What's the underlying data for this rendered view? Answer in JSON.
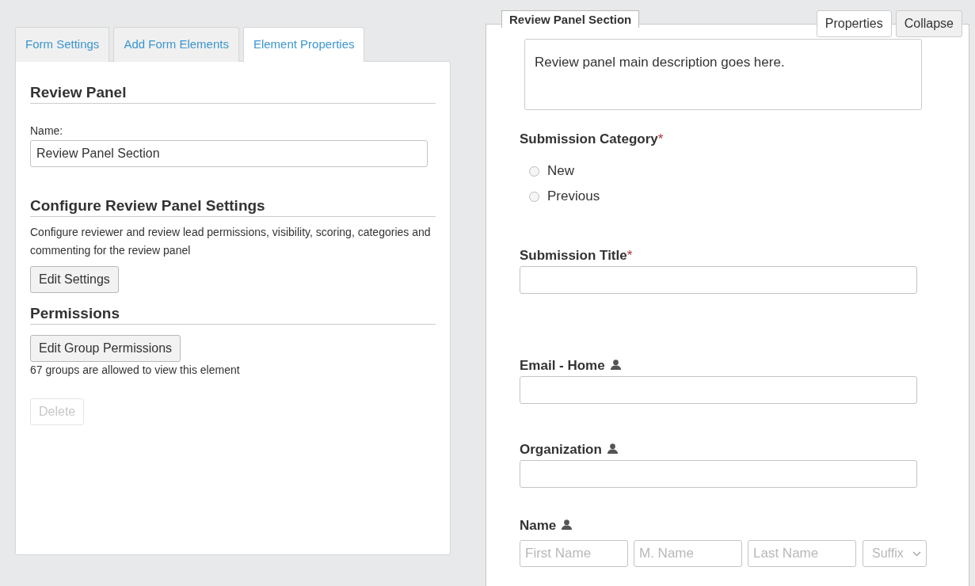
{
  "tabs": [
    {
      "label": "Form Settings",
      "selected": false
    },
    {
      "label": "Add Form Elements",
      "selected": false
    },
    {
      "label": "Element Properties",
      "selected": true
    }
  ],
  "element_properties": {
    "heading": "Review Panel",
    "name_label": "Name:",
    "name_value": "Review Panel Section",
    "settings_heading": "Configure Review Panel Settings",
    "settings_description": "Configure reviewer and review lead permissions, visibility, scoring, categories and commenting for the review panel",
    "settings_button": "Edit Settings",
    "permissions_heading": "Permissions",
    "permissions_button": "Edit Group Permissions",
    "permissions_note": "67 groups are allowed to view this element",
    "delete_button": {
      "label": "Delete",
      "disabled": true
    }
  },
  "section": {
    "title": "Review Panel Section",
    "buttons": [
      {
        "label": "Properties",
        "hovered": true
      },
      {
        "label": "Collapse",
        "hovered": false
      }
    ],
    "description": "Review panel main description goes here.",
    "fields": [
      {
        "kind": "radio",
        "label": "Submission Category",
        "required_mark": "*",
        "options": [
          {
            "label": "New",
            "selected": false
          },
          {
            "label": "Previous",
            "selected": false
          }
        ]
      },
      {
        "kind": "text",
        "label": "Submission Title",
        "required_mark": "*",
        "profile_linked": false
      },
      {
        "kind": "text",
        "label": "Email - Home",
        "profile_linked": true
      },
      {
        "kind": "text",
        "label": "Organization",
        "profile_linked": true
      },
      {
        "kind": "name",
        "label": "Name",
        "profile_linked": true,
        "placeholders": [
          "First Name",
          "M. Name",
          "Last Name"
        ],
        "suffix_placeholder": "Suffix"
      }
    ]
  }
}
